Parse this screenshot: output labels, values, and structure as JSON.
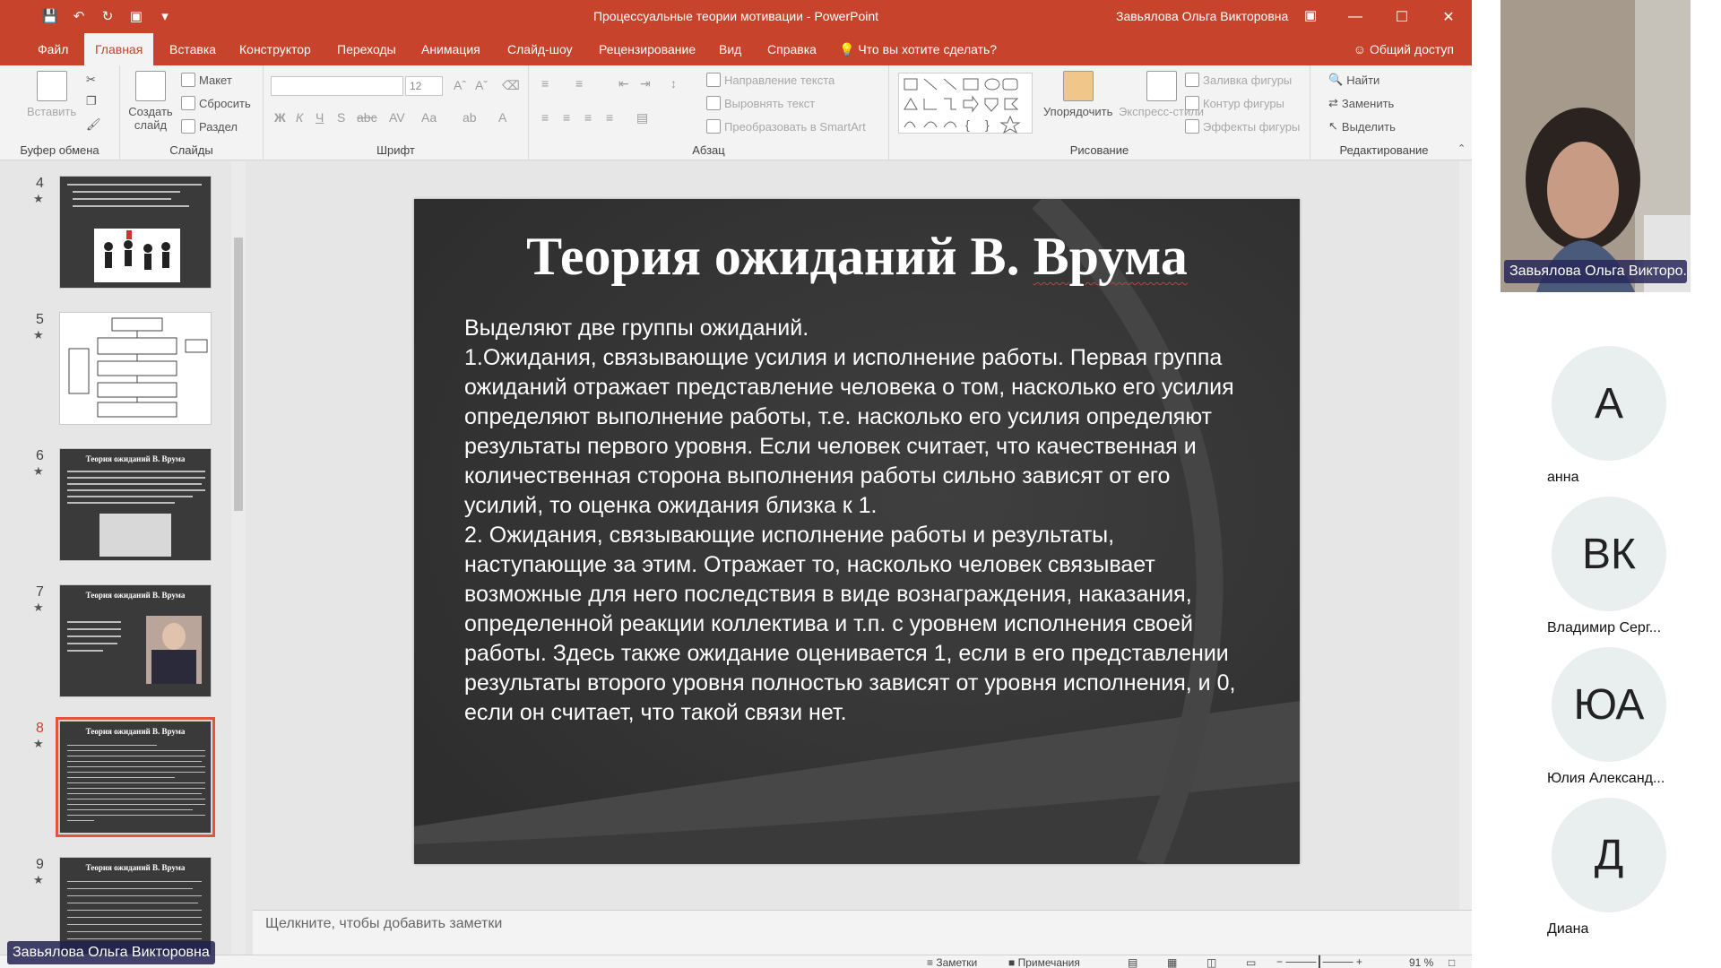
{
  "window": {
    "title": "Процессуальные теории мотивации - PowerPoint",
    "user": "Завьялова Ольга Викторовна"
  },
  "tabs": [
    "Файл",
    "Главная",
    "Вставка",
    "Конструктор",
    "Переходы",
    "Анимация",
    "Слайд-шоу",
    "Рецензирование",
    "Вид",
    "Справка"
  ],
  "active_tab": "Главная",
  "tell_me": "Что вы хотите сделать?",
  "share": "Общий доступ",
  "ribbon": {
    "clipboard": {
      "label": "Буфер обмена",
      "paste": "Вставить"
    },
    "slides": {
      "label": "Слайды",
      "new_slide": "Создать слайд",
      "layout": "Макет",
      "reset": "Сбросить",
      "section": "Раздел"
    },
    "font": {
      "label": "Шрифт",
      "size": "12"
    },
    "paragraph": {
      "label": "Абзац",
      "text_direction": "Направление текста",
      "align_text": "Выровнять текст",
      "smartart": "Преобразовать в SmartArt"
    },
    "drawing": {
      "label": "Рисование",
      "arrange": "Упорядочить",
      "quick_styles": "Экспресс-стили",
      "fill": "Заливка фигуры",
      "outline": "Контур фигуры",
      "effects": "Эффекты фигуры"
    },
    "editing": {
      "label": "Редактирование",
      "find": "Найти",
      "replace": "Заменить",
      "select": "Выделить"
    }
  },
  "thumbnails": [
    {
      "num": "4",
      "title": ""
    },
    {
      "num": "5",
      "title": ""
    },
    {
      "num": "6",
      "title": "Теория ожиданий В. Врума"
    },
    {
      "num": "7",
      "title": "Теория ожиданий В. Врума"
    },
    {
      "num": "8",
      "title": "Теория ожиданий В. Врума"
    },
    {
      "num": "9",
      "title": "Теория ожиданий В. Врума"
    }
  ],
  "current_slide": "8",
  "slide": {
    "title_plain": "Теория ожиданий В. ",
    "title_marked": "Врума",
    "paragraphs": [
      "Выделяют две группы ожиданий.",
      "1.Ожидания, связывающие усилия и исполнение работы. Первая группа ожиданий отражает представление человека о том, насколько его усилия определяют выполнение работы, т.е. насколько его усилия определяют результаты первого уровня. Если человек считает, что качественная и количественная сторона выполнения работы сильно зависят от его усилий, то оценка ожидания близка к 1.",
      "2. Ожидания, связывающие исполнение работы и результаты, наступающие за этим. Отражает то, насколько человек связывает возможные для него последствия в виде вознаграждения, наказания, определенной реакции коллектива и т.п. с уровнем исполнения своей работы. Здесь также ожидание оценивается 1, если в его представлении результаты второго уровня полностью зависят от уровня исполнения, и 0, если он считает, что такой связи нет."
    ]
  },
  "notes_placeholder": "Щелкните, чтобы добавить заметки",
  "status": {
    "notes": "Заметки",
    "comments": "Примечания",
    "zoom": "91 %"
  },
  "presenter_tag": "Завьялова Ольга Викторовна",
  "conference": {
    "video_name": "Завьялова Ольга Викторо...",
    "participants": [
      {
        "initials": "А",
        "name": "анна"
      },
      {
        "initials": "ВК",
        "name": "Владимир Серг..."
      },
      {
        "initials": "ЮА",
        "name": "Юлия Александ..."
      },
      {
        "initials": "Д",
        "name": "Диана"
      }
    ]
  },
  "colors": {
    "accent": "#c7432b",
    "slide_bg": "#3b3b3b",
    "selection": "#e2553a"
  }
}
